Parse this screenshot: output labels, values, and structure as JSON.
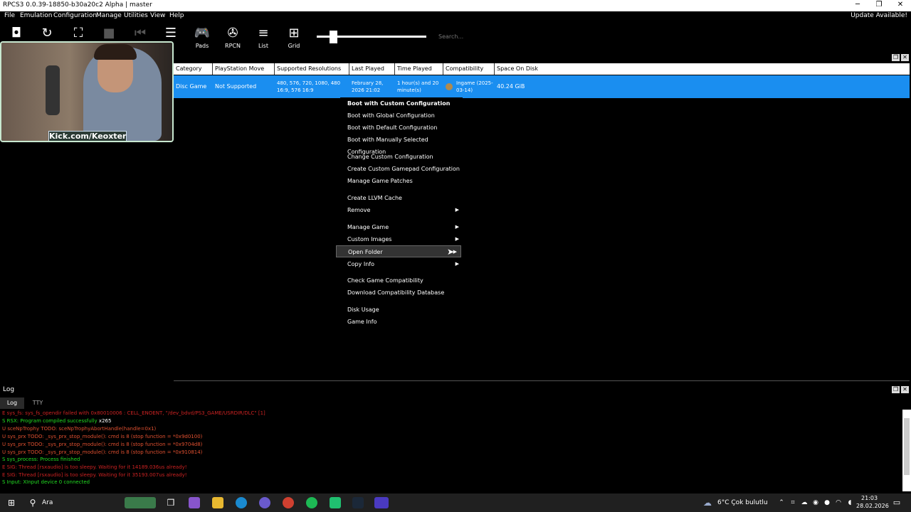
{
  "window": {
    "title": "RPCS3 0.0.39-18850-b30a20c2 Alpha | master",
    "minimize": "─",
    "restore": "❐",
    "close": "✕"
  },
  "menubar": {
    "items": [
      "File",
      "Emulation",
      "Configuration",
      "Manage",
      "Utilities",
      "View",
      "Help"
    ],
    "update": "Update Available!"
  },
  "toolbar": {
    "tools": [
      {
        "label": "Pads",
        "icon": "gamepad-icon"
      },
      {
        "label": "RPCN",
        "icon": "rpcn-icon"
      },
      {
        "label": "List",
        "icon": "list-icon"
      },
      {
        "label": "Grid",
        "icon": "grid-icon"
      }
    ],
    "search_placeholder": "Search..."
  },
  "table": {
    "headers": [
      "Category",
      "PlayStation Move",
      "Supported Resolutions",
      "Last Played",
      "Time Played",
      "Compatibility",
      "Space On Disk"
    ],
    "row": {
      "category": "Disc Game",
      "move": "Not Supported",
      "resolutions": "480, 576, 720, 1080, 480 16:9, 576 16:9",
      "last_played": "February 28, 2026 21:02",
      "time_played": "1 hour(s) and 20 minute(s)",
      "compatibility": "Ingame (2025-03-14)",
      "space": "40.24 GiB"
    }
  },
  "webcam": {
    "caption": "Kick.com/Keoxter"
  },
  "context_menu": {
    "items": [
      {
        "label": "Boot with Custom Configuration",
        "bold": true
      },
      {
        "label": "Boot with Global Configuration"
      },
      {
        "label": "Boot with Default Configuration"
      },
      {
        "label": "Boot with Manually Selected Configuration"
      },
      {
        "label": "Change Custom Configuration"
      },
      {
        "label": "Create Custom Gamepad Configuration"
      },
      {
        "label": "Manage Game Patches"
      },
      {
        "label": "Create LLVM Cache"
      },
      {
        "label": "Remove",
        "submenu": true
      },
      {
        "label": "Manage Game",
        "submenu": true
      },
      {
        "label": "Custom Images",
        "submenu": true
      },
      {
        "label": "Open Folder",
        "submenu": true,
        "highlighted": true
      },
      {
        "label": "Copy Info",
        "submenu": true
      },
      {
        "label": "Check Game Compatibility"
      },
      {
        "label": "Download Compatibility Database"
      },
      {
        "label": "Disk Usage"
      },
      {
        "label": "Game Info"
      }
    ]
  },
  "log": {
    "title": "Log",
    "tabs": [
      "Log",
      "TTY"
    ],
    "lines": [
      {
        "text": "E sys_fs: sys_fs_opendir failed with 0x80010006 : CELL_ENOENT, \"/dev_bdvd/PS3_GAME/USRDIR/DLC\" [1]",
        "color": "#cc2222"
      },
      {
        "text": "S RSX: Program compiled successfully",
        "color": "#22dd22"
      },
      {
        "text": "U sceNpTrophy TODO: sceNpTrophyAbortHandle(handle=0x1)",
        "color": "#e05030"
      },
      {
        "text": "U sys_prx TODO: _sys_prx_stop_module(): cmd is 8 (stop function = *0x9d0100)",
        "color": "#e05030"
      },
      {
        "text": "U sys_prx TODO: _sys_prx_stop_module(): cmd is 8 (stop function = *0x9704d8)",
        "color": "#e05030"
      },
      {
        "text": "U sys_prx TODO: _sys_prx_stop_module(): cmd is 8 (stop function = *0x910814)",
        "color": "#e05030"
      },
      {
        "text": "S sys_process: Process finished",
        "color": "#22dd22"
      },
      {
        "text": "E SIG: Thread [rsxaudio] is too sleepy. Waiting for it 14189.036us already!",
        "color": "#cc2222"
      },
      {
        "text": "E SIG: Thread [rsxaudio] is too sleepy. Waiting for it 35193.007us already!",
        "color": "#cc2222"
      },
      {
        "text": "S Input: XInput device 0 connected",
        "color": "#22dd22"
      }
    ],
    "count_suffix": "x265"
  },
  "taskbar": {
    "search": "Ara",
    "weather": "6°C  Çok bulutlu",
    "time": "21:03",
    "date": "28.02.2026"
  }
}
